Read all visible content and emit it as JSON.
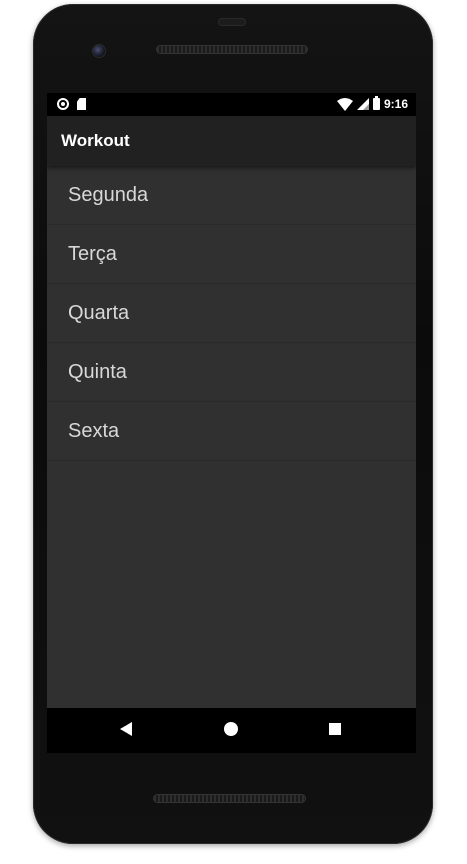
{
  "status_bar": {
    "time": "9:16",
    "left_icons": [
      "circle-dot-icon",
      "sd-card-icon"
    ],
    "right_icons": [
      "wifi-icon",
      "signal-icon",
      "battery-icon"
    ]
  },
  "app_bar": {
    "title": "Workout"
  },
  "days": [
    {
      "label": "Segunda"
    },
    {
      "label": "Terça"
    },
    {
      "label": "Quarta"
    },
    {
      "label": "Quinta"
    },
    {
      "label": "Sexta"
    }
  ],
  "fab": {
    "label": "+",
    "icon": "add-icon",
    "color": "#3700b3"
  },
  "nav_bar": {
    "icons": [
      "back-icon",
      "home-icon",
      "recents-icon"
    ]
  },
  "colors": {
    "app_bar": "#212121",
    "background": "#303030",
    "accent": "#3700b3",
    "text": "#d8d8d8"
  }
}
